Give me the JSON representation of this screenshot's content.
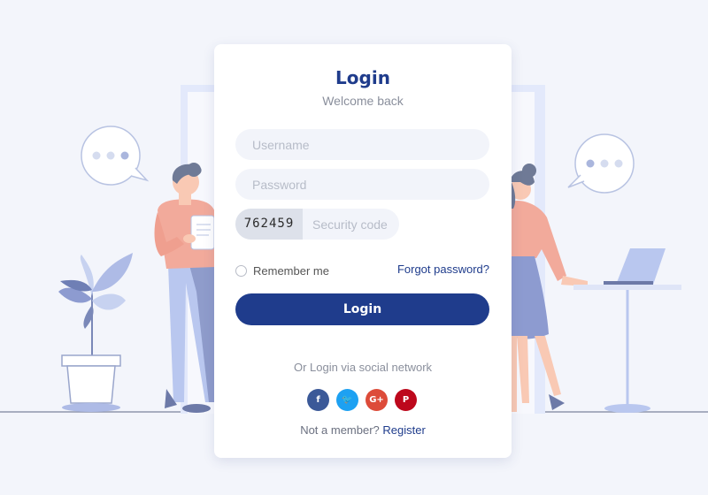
{
  "login": {
    "title": "Login",
    "subtitle": "Welcome back",
    "username_placeholder": "Username",
    "password_placeholder": "Password",
    "captcha_code": "762459",
    "security_placeholder": "Security code",
    "remember_label": "Remember me",
    "remember_checked": false,
    "forgot_label": "Forgot password?",
    "button_label": "Login",
    "social_text": "Or Login via social network",
    "social": [
      {
        "icon": "facebook-icon",
        "glyph": "f",
        "color": "#3b5998"
      },
      {
        "icon": "twitter-icon",
        "glyph": "🐦",
        "color": "#1da1f2"
      },
      {
        "icon": "google-plus-icon",
        "glyph": "G+",
        "color": "#dd4b39"
      },
      {
        "icon": "pinterest-icon",
        "glyph": "P",
        "color": "#bd081c"
      }
    ],
    "signup_prompt": "Not a member?",
    "signup_link": "Register"
  },
  "colors": {
    "accent": "#1f3c8c",
    "background": "#f3f5fb",
    "field": "#f2f4fa"
  }
}
